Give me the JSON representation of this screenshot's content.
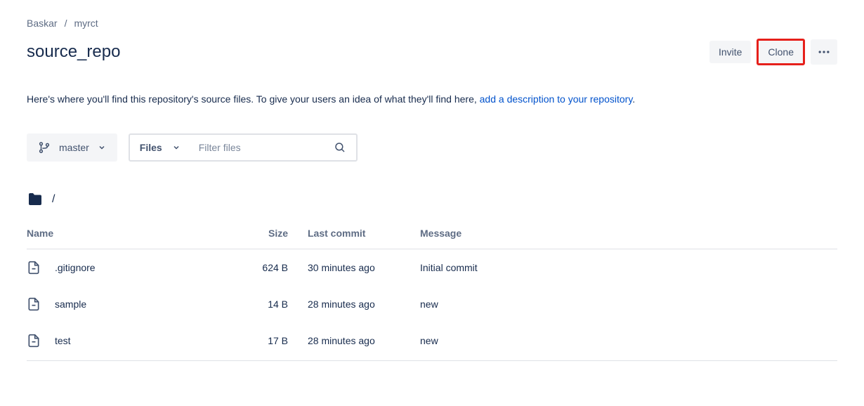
{
  "breadcrumb": {
    "owner": "Baskar",
    "repo": "myrct"
  },
  "title": "source_repo",
  "actions": {
    "invite": "Invite",
    "clone": "Clone"
  },
  "description": {
    "text": "Here's where you'll find this repository's source files. To give your users an idea of what they'll find here, ",
    "link": "add a description to your repository"
  },
  "branch": {
    "name": "master"
  },
  "filesSelector": "Files",
  "filterPlaceholder": "Filter files",
  "path": "/",
  "columns": {
    "name": "Name",
    "size": "Size",
    "lastCommit": "Last commit",
    "message": "Message"
  },
  "files": [
    {
      "name": ".gitignore",
      "size": "624 B",
      "lastCommit": "30 minutes ago",
      "message": "Initial commit"
    },
    {
      "name": "sample",
      "size": "14 B",
      "lastCommit": "28 minutes ago",
      "message": "new"
    },
    {
      "name": "test",
      "size": "17 B",
      "lastCommit": "28 minutes ago",
      "message": "new"
    }
  ]
}
